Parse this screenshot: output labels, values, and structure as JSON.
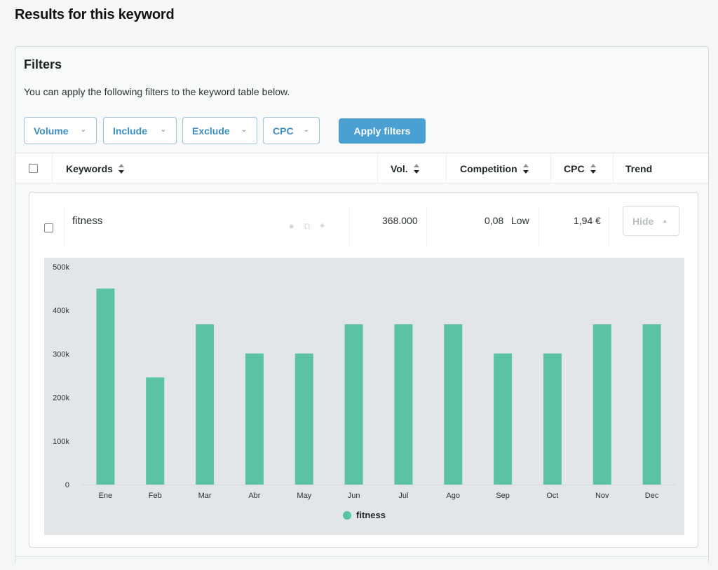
{
  "page": {
    "title": "Results for this keyword"
  },
  "filters": {
    "title": "Filters",
    "description": "You can apply the following filters to the keyword table below.",
    "dropdowns": [
      {
        "label": "Volume",
        "icon": "chevron-down-icon"
      },
      {
        "label": "Include",
        "icon": "chevron-down-icon"
      },
      {
        "label": "Exclude",
        "icon": "chevron-down-icon"
      },
      {
        "label": "CPC",
        "icon": "chevron-down-icon"
      }
    ],
    "apply_label": "Apply filters"
  },
  "table": {
    "columns": [
      {
        "label": "Keywords",
        "sortable": true
      },
      {
        "label": "Vol.",
        "sortable": true
      },
      {
        "label": "Competition",
        "sortable": true
      },
      {
        "label": "CPC",
        "sortable": true
      },
      {
        "label": "Trend",
        "sortable": false
      }
    ],
    "rows": [
      {
        "keyword": "fitness",
        "volume": "368.000",
        "competition_value": "0,08",
        "competition_level": "Low",
        "cpc": "1,94 €",
        "trend_toggle_label": "Hide",
        "row_icons": [
          "add-circle-icon",
          "copy-icon",
          "sparkle-icon"
        ]
      }
    ]
  },
  "colors": {
    "accent": "#4a9fd3",
    "bar": "#5bc2a3",
    "chart_bg": "#e2e6e8"
  },
  "chart_data": {
    "type": "bar",
    "title": "",
    "xlabel": "",
    "ylabel": "",
    "categories": [
      "Ene",
      "Feb",
      "Mar",
      "Abr",
      "May",
      "Jun",
      "Jul",
      "Ago",
      "Sep",
      "Oct",
      "Nov",
      "Dec"
    ],
    "series": [
      {
        "name": "fitness",
        "values": [
          450000,
          246000,
          368000,
          301000,
          301000,
          368000,
          368000,
          368000,
          301000,
          301000,
          368000,
          368000
        ]
      }
    ],
    "ylim": [
      0,
      500000
    ],
    "yticks": [
      0,
      100000,
      200000,
      300000,
      400000,
      500000
    ],
    "ytick_labels": [
      "0",
      "100k",
      "200k",
      "300k",
      "400k",
      "500k"
    ],
    "grid": false,
    "legend": "bottom-center"
  }
}
